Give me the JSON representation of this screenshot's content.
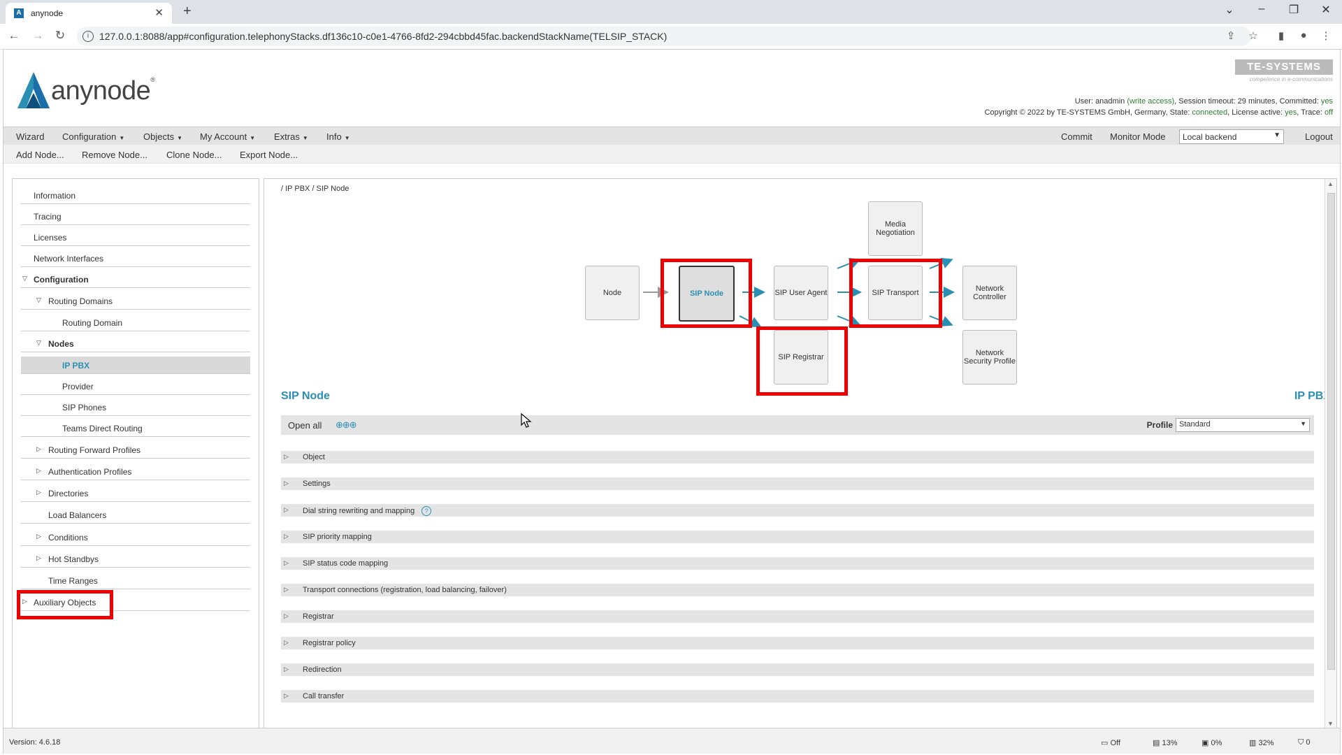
{
  "browser": {
    "tab_title": "anynode",
    "url": "127.0.0.1:8088/app#configuration.telephonyStacks.df136c10-c0e1-4766-8fd2-294cbbd45fac.backendStackName(TELSIP_STACK)"
  },
  "header": {
    "logo_text": "anynode",
    "logo_reg": "®",
    "brand": "TE-SYSTEMS",
    "brand_tagline": "competence in e-communications",
    "user_label": "User: ",
    "user": "anadmin",
    "write_access": "(write access)",
    "session_timeout": ", Session timeout: 29 minutes, Committed: ",
    "committed": "yes",
    "copyright": "Copyright © 2022 by TE-SYSTEMS GmbH, Germany, State: ",
    "state": "connected",
    "license_label": ", License active: ",
    "license": "yes",
    "trace_label": ", Trace: ",
    "trace": "off"
  },
  "menubar": {
    "wizard": "Wizard",
    "configuration": "Configuration",
    "objects": "Objects",
    "my_account": "My Account",
    "extras": "Extras",
    "info": "Info",
    "commit": "Commit",
    "monitor_mode": "Monitor Mode",
    "backend": "Local backend",
    "logout": "Logout"
  },
  "toolbar": {
    "add_node": "Add Node...",
    "remove_node": "Remove Node...",
    "clone_node": "Clone Node...",
    "export_node": "Export Node..."
  },
  "nav": {
    "information": "Information",
    "tracing": "Tracing",
    "licenses": "Licenses",
    "network_interfaces": "Network Interfaces",
    "configuration": "Configuration",
    "routing_domains": "Routing Domains",
    "routing_domain": "Routing Domain",
    "nodes": "Nodes",
    "ip_pbx": "IP PBX",
    "provider": "Provider",
    "sip_phones": "SIP Phones",
    "teams_direct_routing": "Teams Direct Routing",
    "routing_forward_profiles": "Routing Forward Profiles",
    "authentication_profiles": "Authentication Profiles",
    "directories": "Directories",
    "load_balancers": "Load Balancers",
    "conditions": "Conditions",
    "hot_standbys": "Hot Standbys",
    "time_ranges": "Time Ranges",
    "auxiliary_objects": "Auxiliary Objects"
  },
  "main": {
    "breadcrumb": "/ IP PBX / SIP Node",
    "flow": {
      "node": "Node",
      "sip_node": "SIP Node",
      "sip_user_agent": "SIP User Agent",
      "sip_registrar": "SIP Registrar",
      "media_negotiation": "Media Negotiation",
      "sip_transport": "SIP Transport",
      "network_controller": "Network Controller",
      "network_security_profile": "Network Security Profile"
    },
    "section_title": "SIP Node",
    "section_right": "IP PBX",
    "open_all": "Open all",
    "open_all_icons": "⊕⊕⊕",
    "profile_label": "Profile",
    "profile_value": "Standard",
    "sections": [
      "Object",
      "Settings",
      "Dial string rewriting and mapping",
      "SIP priority mapping",
      "SIP status code mapping",
      "Transport connections (registration, load balancing, failover)",
      "Registrar",
      "Registrar policy",
      "Redirection",
      "Call transfer"
    ],
    "help": "?"
  },
  "footer": {
    "version": "Version: 4.6.18",
    "stat1": "Off",
    "stat2": "13%",
    "stat3": "0%",
    "stat4": "32%",
    "stat5": "0"
  },
  "colors": {
    "accent": "#2b8fb3",
    "highlight": "#e00000",
    "ok_green": "#2e7d32"
  }
}
